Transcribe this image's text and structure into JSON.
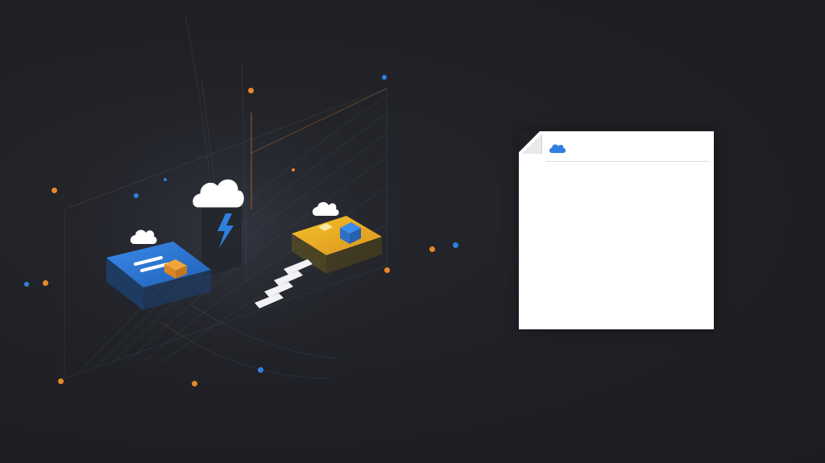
{
  "scene": {
    "background_color": "#1f2025",
    "accent_blue": "#2f7fe0",
    "accent_orange": "#e8892b",
    "accent_yellow": "#f0b51e",
    "icons": [
      "cloud-icon",
      "lightning-bolt-icon",
      "document-card"
    ]
  },
  "document_card": {
    "header_icon": "cloud-icon",
    "header_color": "#2f7fe0"
  }
}
